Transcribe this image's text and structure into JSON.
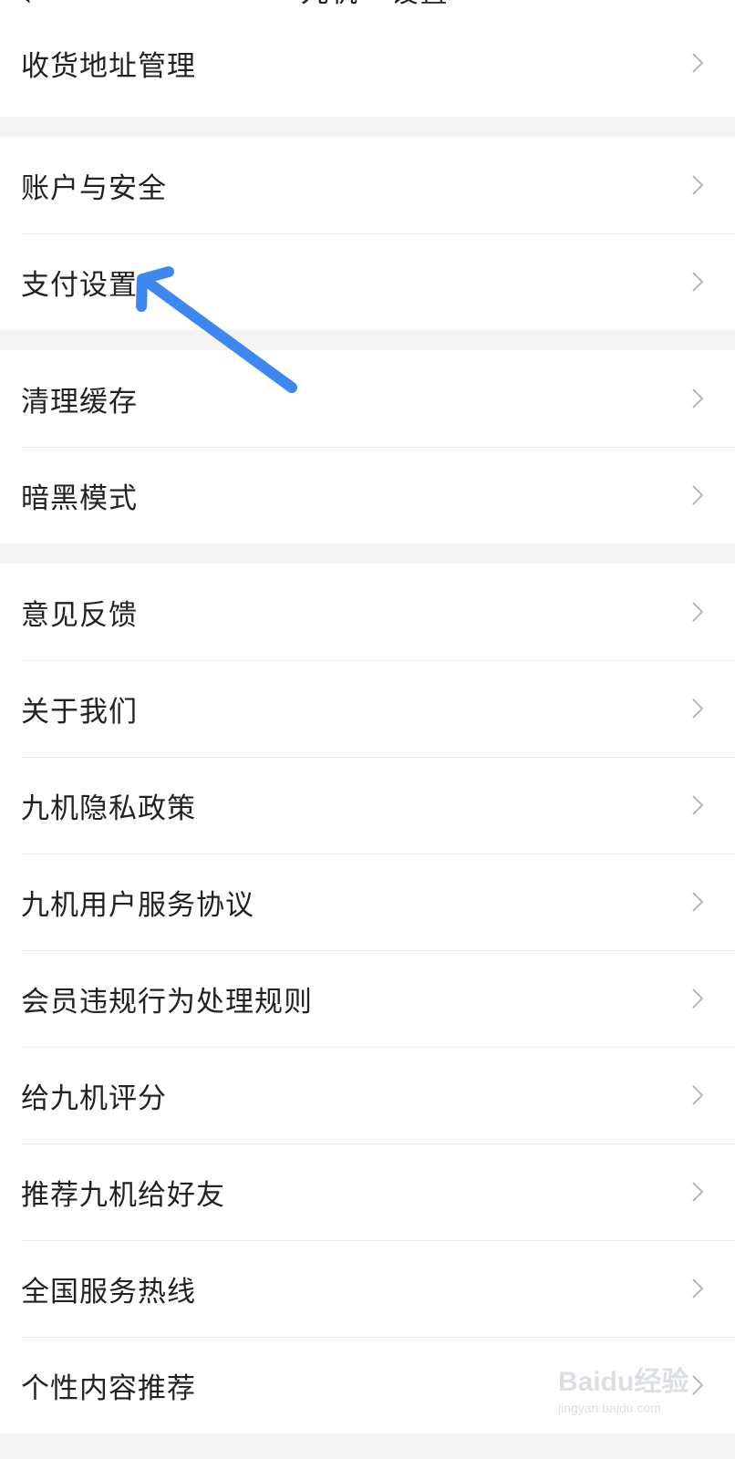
{
  "nav": {
    "back_icon": "chevron-left-icon",
    "title": "九机 · 设置"
  },
  "groups": [
    {
      "items": [
        {
          "label": "收货地址管理"
        }
      ]
    },
    {
      "items": [
        {
          "label": "账户与安全"
        },
        {
          "label": "支付设置"
        }
      ]
    },
    {
      "items": [
        {
          "label": "清理缓存"
        },
        {
          "label": "暗黑模式"
        }
      ]
    },
    {
      "items": [
        {
          "label": "意见反馈"
        },
        {
          "label": "关于我们"
        },
        {
          "label": "九机隐私政策"
        },
        {
          "label": "九机用户服务协议"
        },
        {
          "label": "会员违规行为处理规则"
        },
        {
          "label": "给九机评分"
        },
        {
          "label": "推荐九机给好友"
        },
        {
          "label": "全国服务热线"
        },
        {
          "label": "个性内容推荐"
        }
      ]
    }
  ],
  "annotation": {
    "color": "#3e86f0",
    "icon": "arrow-pointer-icon"
  },
  "watermark": {
    "logo": "Baidu经验",
    "url": "jingyan.baidu.com"
  },
  "colors": {
    "background": "#f4f4f4",
    "row": "#ffffff",
    "text": "#222222",
    "chevron": "#b5b5b5",
    "divider": "#ececec"
  }
}
